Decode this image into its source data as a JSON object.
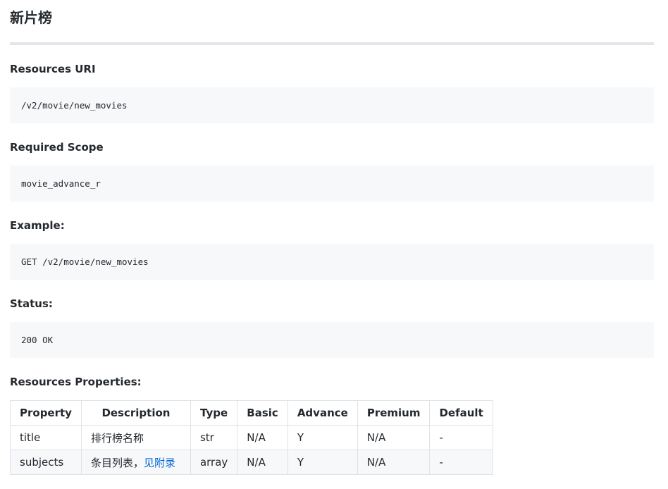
{
  "page": {
    "title": "新片榜"
  },
  "sections": {
    "resources_uri": {
      "label": "Resources URI",
      "code": "/v2/movie/new_movies"
    },
    "required_scope": {
      "label": "Required Scope",
      "code": "movie_advance_r"
    },
    "example": {
      "label": "Example:",
      "code": "GET /v2/movie/new_movies"
    },
    "status": {
      "label": "Status:",
      "code": "200 OK"
    },
    "properties": {
      "label": "Resources Properties:"
    }
  },
  "table": {
    "headers": [
      "Property",
      "Description",
      "Type",
      "Basic",
      "Advance",
      "Premium",
      "Default"
    ],
    "rows": [
      {
        "property": "title",
        "description": "排行榜名称",
        "description_link": "",
        "type": "str",
        "basic": "N/A",
        "advance": "Y",
        "premium": "N/A",
        "default": "-"
      },
      {
        "property": "subjects",
        "description": "条目列表，",
        "description_link": "见附录",
        "type": "array",
        "basic": "N/A",
        "advance": "Y",
        "premium": "N/A",
        "default": "-"
      }
    ]
  },
  "colors": {
    "text": "#24292e",
    "code_background": "#f6f8fa",
    "rule": "#e3e5ea",
    "table_border": "#dfe2e5",
    "link": "#0366d6"
  }
}
